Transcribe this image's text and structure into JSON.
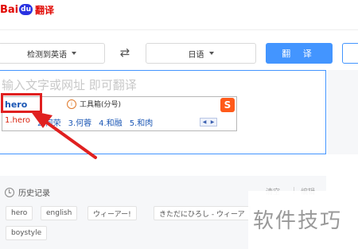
{
  "header": {
    "logo_text": "Bai",
    "logo_paw": "du",
    "logo_product": "翻译"
  },
  "lang": {
    "source_label": "检测到英语",
    "target_label": "日语",
    "swap_symbol": "⇄",
    "translate_label": "翻 译"
  },
  "input": {
    "placeholder": "输入文字或网址 即可翻译"
  },
  "ime": {
    "composition": "hero",
    "toolbox_label": "工具箱(分号)",
    "info_symbol": "i",
    "sogou_symbol": "S",
    "candidates": [
      "1.hero",
      "2.何荣",
      "3.何蓉",
      "4.和融",
      "5.和肉"
    ],
    "pager_prev": "◀",
    "pager_next": "▶"
  },
  "history": {
    "title": "历史记录",
    "clear_label": "清空",
    "separator": "|",
    "edit_label": "编辑",
    "items": [
      "hero",
      "english",
      "ウィーアー!",
      "きただにひろし - ウィーア",
      "boystyle"
    ]
  },
  "watermark": "软件技巧",
  "colors": {
    "accent": "#4395ff",
    "highlight": "#e02020",
    "brand_red": "#e10601"
  }
}
